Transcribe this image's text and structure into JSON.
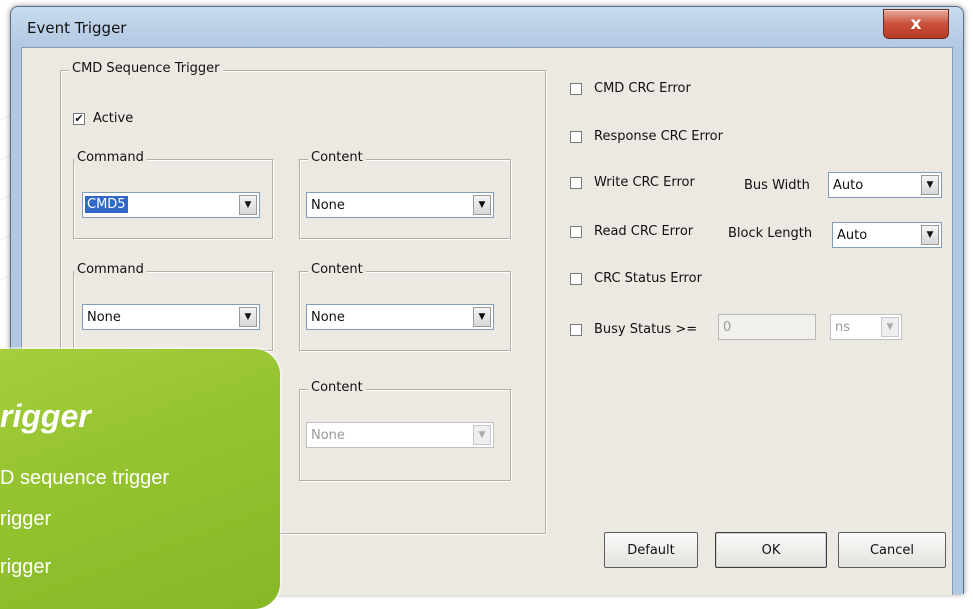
{
  "window": {
    "title": "Event Trigger",
    "close_label": "x"
  },
  "cmd_sequence": {
    "group_title": "CMD Sequence Trigger",
    "active_label": "Active",
    "active_checked": true,
    "check_mark": "✔",
    "rows": [
      {
        "command_title": "Command",
        "command_value": "CMD5",
        "content_title": "Content",
        "content_value": "None"
      },
      {
        "command_title": "Command",
        "command_value": "None",
        "content_title": "Content",
        "content_value": "None"
      },
      {
        "content_title": "Content",
        "content_value": "None"
      }
    ]
  },
  "errors": {
    "cmd_crc": "CMD CRC Error",
    "response_crc": "Response CRC Error",
    "write_crc": "Write CRC Error",
    "read_crc": "Read CRC Error",
    "crc_status": "CRC Status Error",
    "busy_status": "Busy Status >="
  },
  "bus_width": {
    "label": "Bus Width",
    "value": "Auto"
  },
  "block_length": {
    "label": "Block Length",
    "value": "Auto"
  },
  "busy": {
    "value": "0",
    "unit": "ns"
  },
  "buttons": {
    "default": "Default",
    "ok": "OK",
    "cancel": "Cancel"
  },
  "overlay": {
    "title": "rigger",
    "lines": [
      "D sequence trigger",
      "rigger",
      "rigger"
    ]
  },
  "colors": {
    "accent_green": "#94c32f",
    "selection": "#3169c6",
    "dialog_bg": "#ece9e2"
  },
  "icons": {
    "dropdown": "chevron-down-icon",
    "close": "close-icon"
  }
}
